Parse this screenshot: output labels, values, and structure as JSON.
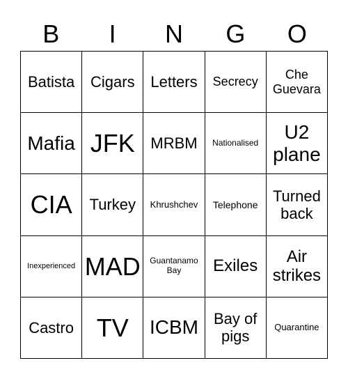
{
  "header": [
    "B",
    "I",
    "N",
    "G",
    "O"
  ],
  "cells": [
    [
      "Batista",
      "Cigars",
      "Letters",
      "Secrecy",
      "Che Guevara"
    ],
    [
      "Mafia",
      "JFK",
      "MRBM",
      "Nationalised",
      "U2 plane"
    ],
    [
      "CIA",
      "Turkey",
      "Khrushchev",
      "Telephone",
      "Turned back"
    ],
    [
      "Inexperienced",
      "MAD",
      "Guantanamo Bay",
      "Exiles",
      "Air strikes"
    ],
    [
      "Castro",
      "TV",
      "ICBM",
      "Bay of pigs",
      "Quarantine"
    ]
  ]
}
